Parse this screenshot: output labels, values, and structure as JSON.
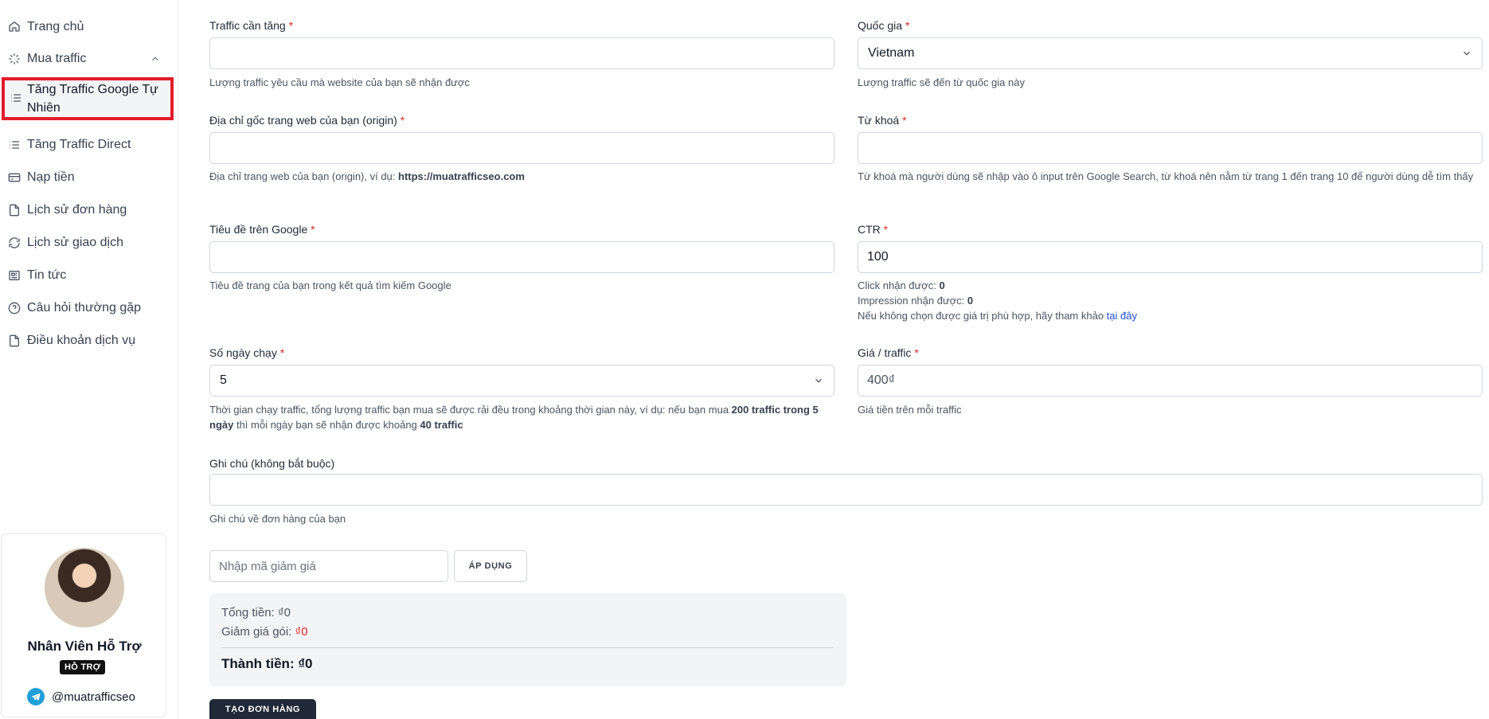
{
  "sidebar": {
    "items": [
      {
        "label": "Trang chủ",
        "icon": "home-icon"
      },
      {
        "label": "Mua traffic",
        "icon": "sparkle-icon"
      },
      {
        "label": "Tăng Traffic Google Tự Nhiên",
        "icon": "list-icon"
      },
      {
        "label": "Tăng Traffic Direct",
        "icon": "list-icon"
      },
      {
        "label": "Nạp tiền",
        "icon": "card-icon"
      },
      {
        "label": "Lịch sử đơn hàng",
        "icon": "file-icon"
      },
      {
        "label": "Lịch sử giao dịch",
        "icon": "refresh-icon"
      },
      {
        "label": "Tin tức",
        "icon": "newspaper-icon"
      },
      {
        "label": "Câu hỏi thường gặp",
        "icon": "help-circle-icon"
      },
      {
        "label": "Điều khoản dịch vụ",
        "icon": "file-icon"
      }
    ],
    "support": {
      "name": "Nhân Viên Hỗ Trợ",
      "badge": "HỖ TRỢ",
      "telegram": "@muatrafficseo"
    }
  },
  "form": {
    "traffic": {
      "label": "Traffic cần tăng",
      "value": "",
      "help": "Lượng traffic yêu cầu mà website của bạn sẽ nhận được"
    },
    "country": {
      "label": "Quốc gia",
      "value": "Vietnam",
      "help": "Lượng traffic sẽ đến từ quốc gia này"
    },
    "origin": {
      "label": "Địa chỉ gốc trang web của bạn (origin)",
      "value": "",
      "help_prefix": "Địa chỉ trang web của bạn (origin), ví dụ: ",
      "help_example": "https://muatrafficseo.com"
    },
    "keyword": {
      "label": "Từ khoá",
      "value": "",
      "help": "Từ khoá mà người dùng sẽ nhập vào ô input trên Google Search, từ khoá nên nằm từ trang 1 đến trang 10 để người dùng dễ tìm thấy"
    },
    "title": {
      "label": "Tiêu đề trên Google",
      "value": "",
      "help": "Tiêu đề trang của bạn trong kết quả tìm kiếm Google"
    },
    "ctr": {
      "label": "CTR",
      "value": "100",
      "click_label": "Click nhận được: ",
      "click_value": "0",
      "impression_label": "Impression nhận được: ",
      "impression_value": "0",
      "hint_prefix": "Nếu không chọn được giá trị phù hợp, hãy tham khảo ",
      "hint_link": "tại đây"
    },
    "days": {
      "label": "Số ngày chạy",
      "value": "5",
      "help_1": "Thời gian chạy traffic, tổng lượng traffic bạn mua sẽ được rải đều trong khoảng thời gian này, ví dụ: nếu bạn mua ",
      "help_b1": "200 traffic",
      "help_b2": "trong 5 ngày",
      "help_2": " thì mỗi ngày bạn sẽ nhận được khoảng ",
      "help_b3": "40 traffic"
    },
    "price": {
      "label": "Giá / traffic",
      "value": "400₫",
      "help": "Giá tiền trên mỗi traffic"
    },
    "note": {
      "label": "Ghi chú (không bắt buộc)",
      "value": "",
      "help": "Ghi chú về đơn hàng của bạn"
    },
    "required_mark": "*"
  },
  "coupon": {
    "placeholder": "Nhập mã giảm giá",
    "apply_label": "ÁP DỤNG"
  },
  "summary": {
    "total_label": "Tổng tiền: ",
    "total_value": "₫0",
    "discount_label": "Giảm giá gói: ",
    "discount_value": "₫0",
    "final_label": "Thành tiền: ",
    "final_value": "₫0"
  },
  "create_button": "TẠO ĐƠN HÀNG",
  "colors": {
    "accent": "#1f2937",
    "required": "#dc2626",
    "highlight_border": "#e11d2a",
    "link": "#1d4ed8"
  }
}
